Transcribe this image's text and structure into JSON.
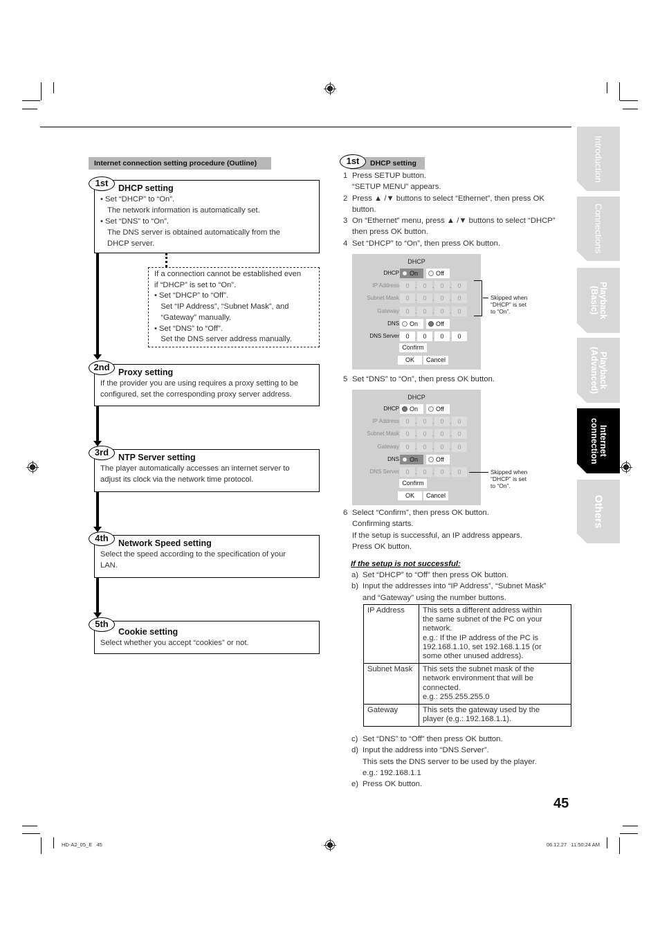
{
  "outline": {
    "heading": "Internet connection setting procedure (Outline)",
    "steps": [
      {
        "badge": "1st",
        "title": "DHCP setting",
        "lines": [
          {
            "bullet": true,
            "text": "Set “DHCP” to “On”."
          },
          {
            "bullet": false,
            "text": "The network information is automatically set."
          },
          {
            "bullet": true,
            "text": "Set “DNS” to “On”."
          },
          {
            "bullet": false,
            "text": "The DNS server is obtained automatically from the"
          },
          {
            "bullet": false,
            "text": "DHCP server."
          }
        ]
      },
      {
        "badge": "2nd",
        "title": "Proxy setting",
        "lines": [
          {
            "text": "If the provider you are using requires a proxy setting to be"
          },
          {
            "text": "configured, set the corresponding proxy server address."
          }
        ]
      },
      {
        "badge": "3rd",
        "title": "NTP Server setting",
        "lines": [
          {
            "text": "The player automatically accesses an internet server to"
          },
          {
            "text": "adjust its clock via the network time protocol."
          }
        ]
      },
      {
        "badge": "4th",
        "title": "Network Speed setting",
        "lines": [
          {
            "text": "Select the speed according to the specification of your"
          },
          {
            "text": "LAN."
          }
        ]
      },
      {
        "badge": "5th",
        "title": "Cookie setting",
        "lines": [
          {
            "text": "Select whether you accept “cookies” or not."
          }
        ]
      }
    ],
    "fallback": [
      "If a connection cannot be established even",
      "if “DHCP” is set to “On”.",
      "• Set “DHCP” to “Off”.",
      "   Set “IP Address”, “Subnet Mask”, and",
      "   “Gateway” manually.",
      "• Set “DNS” to “Off”.",
      "   Set the DNS server address manually."
    ]
  },
  "detail": {
    "badge": "1st",
    "heading": "DHCP setting",
    "steps_a": [
      {
        "n": "1",
        "lines": [
          "Press SETUP button.",
          "“SETUP MENU” appears."
        ]
      },
      {
        "n": "2",
        "lines": [
          "Press ▲ /▼ buttons to select “Ethernet”, then press OK",
          "button."
        ]
      },
      {
        "n": "3",
        "lines": [
          "On “Ethernet” menu, press ▲ /▼ buttons to select “DHCP”",
          "then press OK button."
        ]
      },
      {
        "n": "4",
        "lines": [
          "Set “DHCP” to “On”, then press OK button."
        ]
      }
    ],
    "step5": {
      "n": "5",
      "text": "Set “DNS” to “On”, then press OK button."
    },
    "step6": {
      "n": "6",
      "lines": [
        "Select “Confirm”, then press OK button.",
        "Confirming starts.",
        "If the setup is successful, an IP address appears.",
        "Press OK button."
      ]
    },
    "fail_heading": "If the setup is not successful:",
    "fail_steps_1": [
      {
        "n": "a)",
        "lines": [
          "Set “DHCP” to “Off” then press OK button."
        ]
      },
      {
        "n": "b)",
        "lines": [
          "Input the addresses into “IP Address”, “Subnet Mask”",
          "and “Gateway” using the number buttons."
        ]
      }
    ],
    "table": [
      {
        "field": "IP Address",
        "desc": [
          "This sets a different address within",
          "the same subnet of the PC on your",
          "network.",
          "e.g.: If the IP address of the PC is",
          "192.168.1.10, set 192.168.1.15 (or",
          "some other unused address)."
        ]
      },
      {
        "field": "Subnet Mask",
        "desc": [
          "This sets the subnet mask of the",
          "network environment that will be",
          "connected.",
          "e.g.: 255.255.255.0"
        ]
      },
      {
        "field": "Gateway",
        "desc": [
          "This sets the gateway used by the",
          "player (e.g.: 192.168.1.1)."
        ]
      }
    ],
    "fail_steps_2": [
      {
        "n": "c)",
        "lines": [
          "Set “DNS” to “Off” then press OK button."
        ]
      },
      {
        "n": "d)",
        "lines": [
          "Input the address into “DNS Server”.",
          "This sets the DNS server to be used by the player.",
          "e.g.: 192.168.1.1"
        ]
      },
      {
        "n": "e)",
        "lines": [
          "Press OK button."
        ]
      }
    ]
  },
  "screens": [
    {
      "title": "DHCP",
      "dhcp_label": "DHCP",
      "on_label": "On",
      "off_label": "Off",
      "dhcp_selected": "On",
      "dhcp_highlight": true,
      "fields": [
        {
          "label": "IP Address",
          "values": [
            "0",
            "0",
            "0",
            "0"
          ]
        },
        {
          "label": "Subnet Mask",
          "values": [
            "0",
            "0",
            "0",
            "0"
          ]
        },
        {
          "label": "Gateway",
          "values": [
            "0",
            "0",
            "0",
            "0"
          ]
        }
      ],
      "dns_label": "DNS",
      "dns_selected": "Off",
      "dns_highlight": false,
      "dns_server_label": "DNS Server",
      "dns_server_values": [
        "0",
        "0",
        "0",
        "0"
      ],
      "dns_server_active": true,
      "confirm": "Confirm",
      "ok": "OK",
      "cancel": "Cancel",
      "note": [
        "Skipped when",
        "“DHCP” is set",
        "to “On”."
      ]
    },
    {
      "title": "DHCP",
      "dhcp_label": "DHCP",
      "on_label": "On",
      "off_label": "Off",
      "dhcp_selected": "On",
      "dhcp_highlight": false,
      "fields": [
        {
          "label": "IP Address",
          "values": [
            "0",
            "0",
            "0",
            "0"
          ]
        },
        {
          "label": "Subnet Mask",
          "values": [
            "0",
            "0",
            "0",
            "0"
          ]
        },
        {
          "label": "Gateway",
          "values": [
            "0",
            "0",
            "0",
            "0"
          ]
        }
      ],
      "dns_label": "DNS",
      "dns_selected": "On",
      "dns_highlight": true,
      "dns_server_label": "DNS Server",
      "dns_server_values": [
        "0",
        "0",
        "0",
        "0"
      ],
      "dns_server_active": false,
      "confirm": "Confirm",
      "ok": "OK",
      "cancel": "Cancel",
      "note": [
        "Skipped when",
        "“DHCP” is set",
        "to “On”."
      ]
    }
  ],
  "side_tabs": [
    {
      "label": "Introduction",
      "active": false
    },
    {
      "label": "Connections",
      "active": false
    },
    {
      "label": "Playback\n(Basic)",
      "active": false
    },
    {
      "label": "Playback\n(Advanced)",
      "active": false
    },
    {
      "label": "Internet\nconnection",
      "active": true
    },
    {
      "label": "Others",
      "active": false
    }
  ],
  "page_number": "45",
  "footer": {
    "left": "HD-A2_05_E   45",
    "right": "06.12.27   11:50:24 AM"
  },
  "colors": {
    "heading_bar": "#b8b8b8",
    "panel_bg": "#d0d0d0",
    "tab_inactive": "#d7d7d7",
    "tab_active": "#000000"
  }
}
